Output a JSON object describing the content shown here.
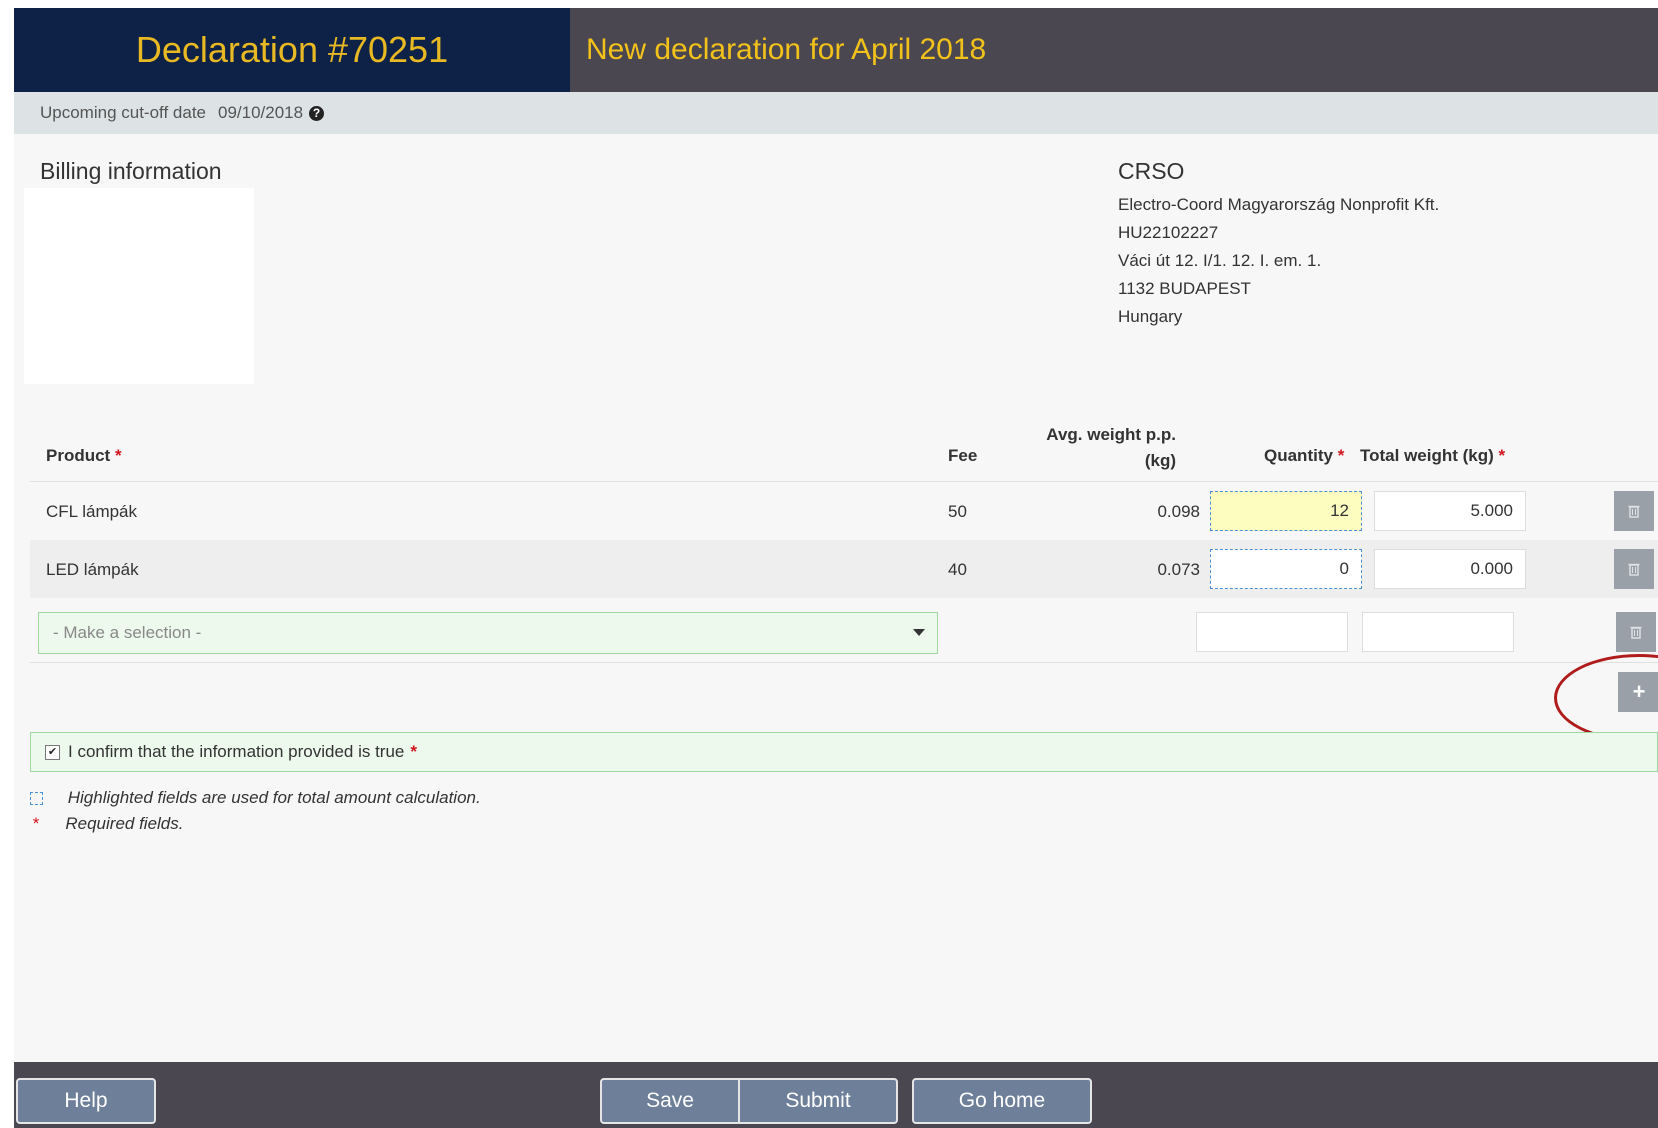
{
  "header": {
    "declaration_title": "Declaration #70251",
    "subtitle": "New declaration for April 2018"
  },
  "cutoff": {
    "label": "Upcoming cut-off date",
    "date": "09/10/2018",
    "help_icon": "?"
  },
  "billing": {
    "title": "Billing information"
  },
  "crso": {
    "name": "CRSO",
    "lines": [
      "Electro-Coord Magyarország Nonprofit Kft.",
      "HU22102227",
      "Váci út 12. I/1. 12. I. em. 1.",
      "1132 BUDAPEST",
      "Hungary"
    ]
  },
  "table": {
    "headers": {
      "product": "Product",
      "fee": "Fee",
      "avg_weight_1": "Avg. weight p.p.",
      "avg_weight_2": "(kg)",
      "quantity": "Quantity",
      "total_weight": "Total weight (kg)",
      "required_mark": "*"
    },
    "rows": [
      {
        "product": "CFL lámpák",
        "fee": "50",
        "avg_weight": "0.098",
        "quantity": "12",
        "total_weight": "5.000"
      },
      {
        "product": "LED lámpák",
        "fee": "40",
        "avg_weight": "0.073",
        "quantity": "0",
        "total_weight": "0.000"
      }
    ],
    "new_row": {
      "placeholder": "- Make a selection -"
    },
    "add_label": "+"
  },
  "confirm": {
    "text": "I confirm that the information provided is true",
    "checked": true
  },
  "legend": {
    "highlighted": "Highlighted fields are used for total amount calculation.",
    "required": "Required fields."
  },
  "footer": {
    "help": "Help",
    "save": "Save",
    "submit": "Submit",
    "go_home": "Go home"
  },
  "colors": {
    "header_left_bg": "#0e2247",
    "header_text": "#f2c21b",
    "header_right_bg": "#4a4750",
    "required": "#d0161c",
    "highlight_border": "#4a90d9",
    "button_bg": "#6e7f99"
  }
}
